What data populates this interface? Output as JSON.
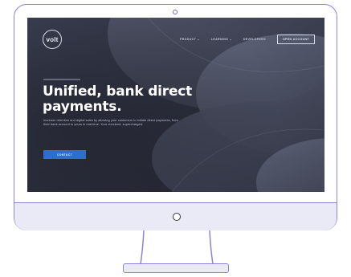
{
  "site": {
    "logo_text": "volt",
    "nav": [
      {
        "label": "PRODUCT ⌄"
      },
      {
        "label": "LEARNING ⌄"
      },
      {
        "label": "DEVELOPERS"
      }
    ],
    "nav_cta": "OPEN ACCOUNT",
    "headline_line1": "Unified, bank direct",
    "headline_line2": "payments.",
    "subtext": "Increase retention and digital sales by allowing your customers to initiate direct payments, from their bank account to yours in real-time. Your checkout, supercharged.",
    "cta_label": "CONTACT"
  },
  "colors": {
    "accent": "#2f6dd0",
    "frame_outline": "#8b84d6",
    "screen_bg": "#2e3140"
  },
  "icons": {
    "camera": "camera-icon",
    "power": "power-button-icon"
  }
}
